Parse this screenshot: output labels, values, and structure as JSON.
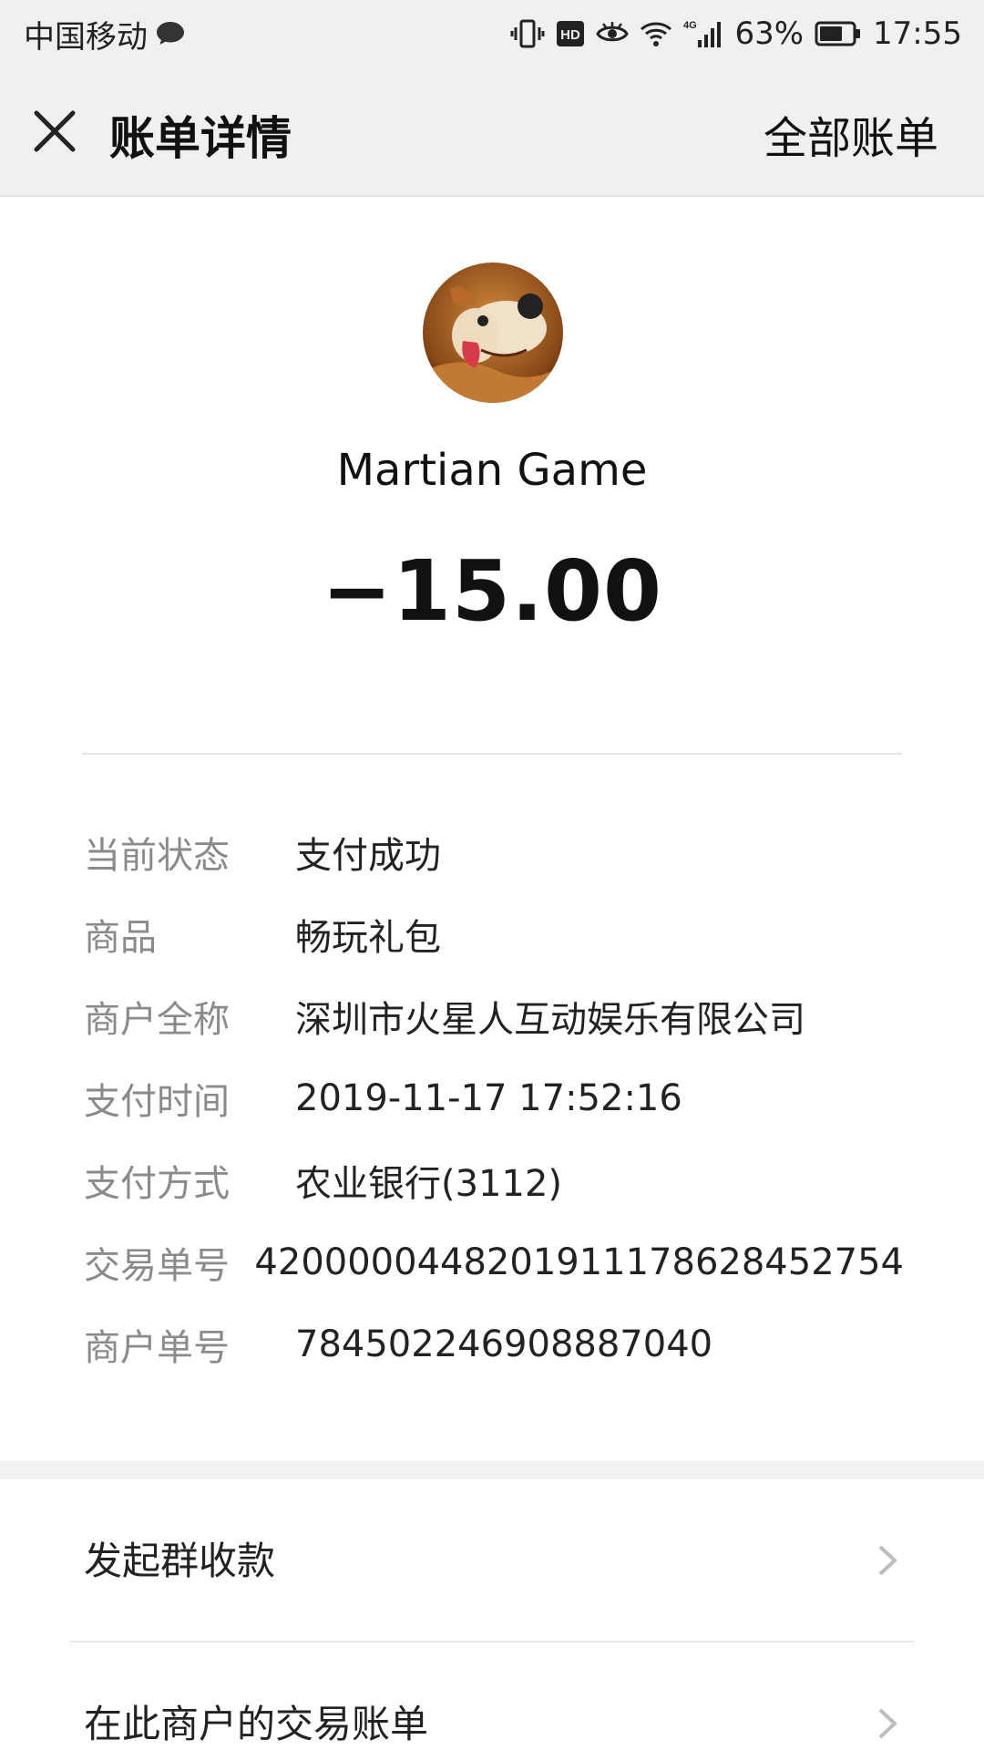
{
  "status_bar": {
    "carrier": "中国移动",
    "hd_label": "HD",
    "network": "4G",
    "battery": "63%",
    "time": "17:55"
  },
  "nav": {
    "title": "账单详情",
    "right_action": "全部账单"
  },
  "header": {
    "merchant": "Martian Game",
    "amount": "−15.00"
  },
  "details": [
    {
      "label": "当前状态",
      "value": "支付成功"
    },
    {
      "label": "商品",
      "value": "畅玩礼包"
    },
    {
      "label": "商户全称",
      "value": "深圳市火星人互动娱乐有限公司"
    },
    {
      "label": "支付时间",
      "value": "2019-11-17 17:52:16"
    },
    {
      "label": "支付方式",
      "value": "农业银行(3112)"
    },
    {
      "label": "交易单号",
      "value": "4200000448201911178628452754"
    },
    {
      "label": "商户单号",
      "value": "784502246908887040"
    }
  ],
  "actions": [
    {
      "label": "发起群收款"
    },
    {
      "label": "在此商户的交易账单"
    }
  ],
  "colors": {
    "bar_bg": "#f0f0f0",
    "label_gray": "#8a8a8a",
    "text": "#222222"
  }
}
